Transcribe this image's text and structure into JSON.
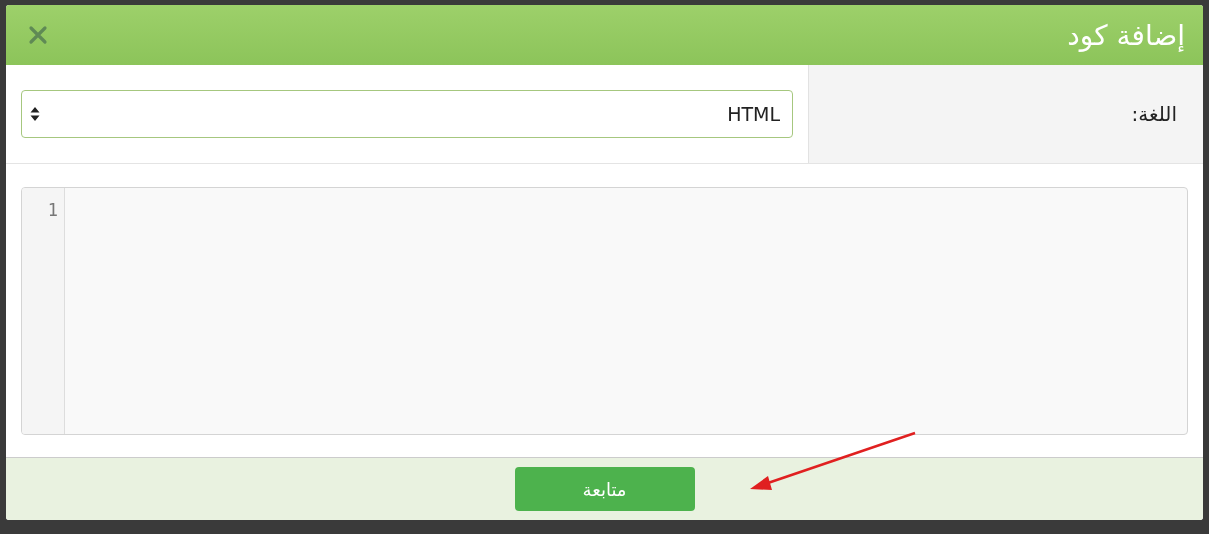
{
  "dialog": {
    "title": "إضافة كود"
  },
  "language": {
    "label": "اللغة:",
    "value": "HTML"
  },
  "editor": {
    "line_numbers": [
      "1"
    ]
  },
  "buttons": [
    "متابعة"
  ]
}
